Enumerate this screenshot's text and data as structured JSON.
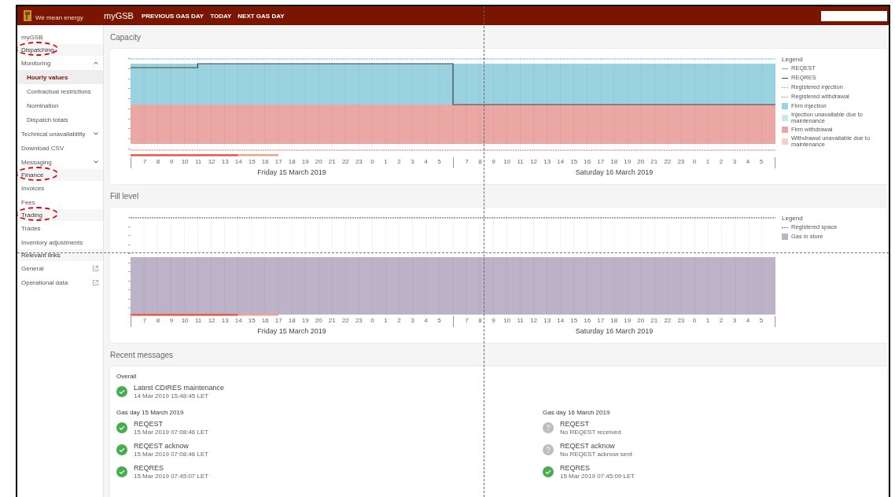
{
  "header": {
    "tagline": "We mean energy",
    "brand": "myGSB",
    "nav": [
      "PREVIOUS GAS DAY",
      "TODAY",
      "NEXT GAS DAY"
    ]
  },
  "sidebar": {
    "items": [
      {
        "label": "myGSB",
        "kind": "link",
        "selected": false
      },
      {
        "label": "Dispatching",
        "kind": "section",
        "circled": true
      },
      {
        "label": "Monitoring",
        "kind": "group",
        "expanded": true,
        "selected": false
      },
      {
        "label": "Hourly values",
        "kind": "sub",
        "selected": true
      },
      {
        "label": "Contractual restrictions",
        "kind": "sub",
        "selected": false
      },
      {
        "label": "Nomination",
        "kind": "sub",
        "selected": false
      },
      {
        "label": "Dispatch totals",
        "kind": "sub",
        "selected": false
      },
      {
        "label": "Technical unavailability",
        "kind": "group",
        "expanded": false,
        "selected": false
      },
      {
        "label": "Download CSV",
        "kind": "link",
        "selected": false
      },
      {
        "label": "Messaging",
        "kind": "group",
        "expanded": false,
        "selected": false
      },
      {
        "label": "Finance",
        "kind": "section",
        "circled": true
      },
      {
        "label": "Invoices",
        "kind": "link",
        "selected": false
      },
      {
        "label": "Fees",
        "kind": "link",
        "selected": false
      },
      {
        "label": "Trading",
        "kind": "section",
        "circled": true
      },
      {
        "label": "Trades",
        "kind": "link",
        "selected": false
      },
      {
        "label": "Inventory adjustments",
        "kind": "link",
        "selected": false
      },
      {
        "label": "Relevant links",
        "kind": "section",
        "circled": false
      },
      {
        "label": "General",
        "kind": "external",
        "selected": false
      },
      {
        "label": "Operational data",
        "kind": "external",
        "selected": false
      }
    ]
  },
  "capacity": {
    "title": "Capacity",
    "kind": "capacity",
    "days": [
      {
        "label": "Friday 15 March 2019",
        "hours": [
          "7",
          "8",
          "9",
          "10",
          "11",
          "12",
          "13",
          "14",
          "15",
          "16",
          "17",
          "18",
          "19",
          "20",
          "21",
          "22",
          "23",
          "0",
          "1",
          "2",
          "3",
          "4",
          "5"
        ]
      },
      {
        "label": "Saturday 16 March 2019",
        "hours": [
          "7",
          "8",
          "9",
          "10",
          "11",
          "12",
          "13",
          "14",
          "15",
          "16",
          "17",
          "18",
          "19",
          "20",
          "21",
          "22",
          "23",
          "0",
          "1",
          "2",
          "3",
          "4",
          "5"
        ]
      }
    ],
    "legend_title": "Legend",
    "legend": [
      {
        "label": "REQEST",
        "kind": "line",
        "color": "#9a9a9a"
      },
      {
        "label": "REQRES",
        "kind": "line",
        "color": "#444444"
      },
      {
        "label": "Registered injection",
        "kind": "dashed",
        "color": "#5bbcd0"
      },
      {
        "label": "Registered withdrawal",
        "kind": "dashed",
        "color": "#e57373"
      },
      {
        "label": "Firm injection",
        "kind": "swatch",
        "color": "#9ad3df"
      },
      {
        "label": "Injection unavailable due to maintenance",
        "kind": "swatch",
        "color": "#c8e9f0"
      },
      {
        "label": "Firm withdrawal",
        "kind": "swatch",
        "color": "#eba7a4"
      },
      {
        "label": "Withdrawal unavailable due to maintenance",
        "kind": "swatch",
        "color": "#f4cfcd"
      }
    ]
  },
  "fill_level": {
    "title": "Fill level",
    "kind": "fill",
    "days": [
      {
        "label": "Friday 15 March 2019",
        "hours": [
          "7",
          "8",
          "9",
          "10",
          "11",
          "12",
          "13",
          "14",
          "15",
          "16",
          "17",
          "18",
          "19",
          "20",
          "21",
          "22",
          "23",
          "0",
          "1",
          "2",
          "3",
          "4",
          "5"
        ]
      },
      {
        "label": "Saturday 16 March 2019",
        "hours": [
          "7",
          "8",
          "9",
          "10",
          "11",
          "12",
          "13",
          "14",
          "15",
          "16",
          "17",
          "18",
          "19",
          "20",
          "21",
          "22",
          "23",
          "0",
          "1",
          "2",
          "3",
          "4",
          "5"
        ]
      }
    ],
    "legend_title": "Legend",
    "legend": [
      {
        "label": "Registered space",
        "kind": "dashed",
        "color": "#55507a"
      },
      {
        "label": "Gas in store",
        "kind": "swatch",
        "color": "#bdb3c9"
      }
    ]
  },
  "messages": {
    "title": "Recent messages",
    "overall_title": "Overall",
    "overall": [
      {
        "title": "Latest CDIRES maintenance",
        "detail": "14 Mar 2019 15:48:45 LET",
        "kind": "ok"
      }
    ],
    "days": [
      {
        "title": "Gas day 15 March 2019",
        "items": [
          {
            "title": "REQEST",
            "detail": "15 Mar 2019 07:08:46 LET",
            "kind": "ok"
          },
          {
            "title": "REQEST acknow",
            "detail": "15 Mar 2019 07:08:46 LET",
            "kind": "ok"
          },
          {
            "title": "REQRES",
            "detail": "15 Mar 2019 07:45:07 LET",
            "kind": "ok"
          }
        ]
      },
      {
        "title": "Gas day 16 March 2019",
        "items": [
          {
            "title": "REQEST",
            "detail": "No REQEST received",
            "kind": "unknown"
          },
          {
            "title": "REQEST acknow",
            "detail": "No REQEST acknow sent",
            "kind": "unknown"
          },
          {
            "title": "REQRES",
            "detail": "15 Mar 2019 07:45:09 LET",
            "kind": "ok"
          }
        ]
      }
    ]
  }
}
